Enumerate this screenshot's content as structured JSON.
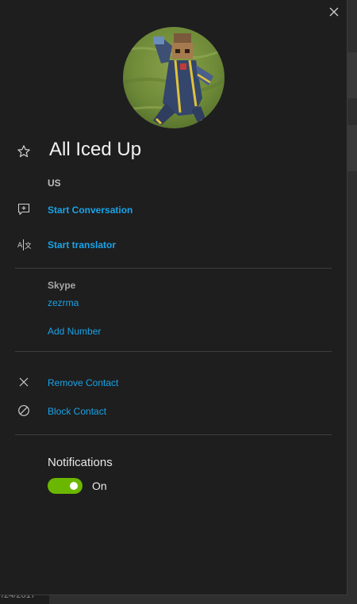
{
  "contact": {
    "name": "All Iced Up",
    "country": "US"
  },
  "actions": {
    "start_conversation": "Start Conversation",
    "start_translator": "Start translator"
  },
  "skype": {
    "label": "Skype",
    "username": "zezrma",
    "add_number": "Add Number"
  },
  "manage": {
    "remove_contact": "Remove Contact",
    "block_contact": "Block Contact"
  },
  "notifications": {
    "title": "Notifications",
    "toggle_state": "On",
    "enabled": true
  },
  "background": {
    "date_fragment": "/24/2017"
  },
  "icons": {
    "close": "close-icon",
    "favorite": "star-icon",
    "conversation": "add-chat-icon",
    "translator": "translate-icon",
    "remove": "close-icon",
    "block": "block-icon"
  },
  "colors": {
    "panel_bg": "#1e1e1e",
    "link": "#1aa3e8",
    "toggle_on": "#6bb700",
    "divider": "#3e3e3e"
  }
}
